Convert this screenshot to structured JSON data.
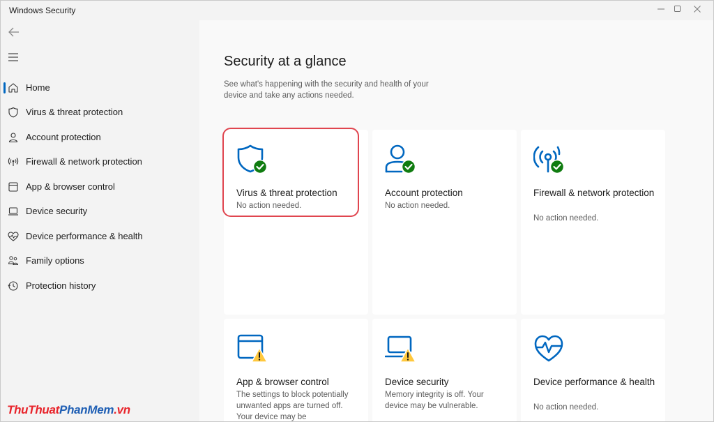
{
  "app": {
    "title": "Windows Security"
  },
  "window_controls": {
    "minimize": "minimize-icon",
    "maximize": "maximize-icon",
    "close": "close-icon"
  },
  "sidebar": {
    "items": [
      {
        "label": "Home",
        "icon": "home-icon",
        "active": true
      },
      {
        "label": "Virus & threat protection",
        "icon": "shield-icon"
      },
      {
        "label": "Account protection",
        "icon": "person-icon"
      },
      {
        "label": "Firewall & network protection",
        "icon": "antenna-icon"
      },
      {
        "label": "App & browser control",
        "icon": "app-window-icon"
      },
      {
        "label": "Device security",
        "icon": "laptop-icon"
      },
      {
        "label": "Device performance & health",
        "icon": "heart-pulse-icon"
      },
      {
        "label": "Family options",
        "icon": "family-icon"
      },
      {
        "label": "Protection history",
        "icon": "history-icon"
      }
    ]
  },
  "main": {
    "title": "Security at a glance",
    "subtitle": "See what's happening with the security and health of your device and take any actions needed.",
    "cards": [
      {
        "title": "Virus & threat protection",
        "status": "No action needed.",
        "icon": "shield-check-icon",
        "state": "ok"
      },
      {
        "title": "Account protection",
        "status": "No action needed.",
        "icon": "person-check-icon",
        "state": "ok"
      },
      {
        "title": "Firewall & network protection",
        "status": "No action needed.",
        "icon": "antenna-check-icon",
        "state": "ok"
      },
      {
        "title": "App & browser control",
        "status": "The settings to block potentially unwanted apps are turned off. Your device may be",
        "icon": "app-window-warning-icon",
        "state": "warning"
      },
      {
        "title": "Device security",
        "status": "Memory integrity is off. Your device may be vulnerable.",
        "icon": "laptop-warning-icon",
        "state": "warning"
      },
      {
        "title": "Device performance & health",
        "status": "No action needed.",
        "icon": "heart-check-icon",
        "state": "ok"
      }
    ]
  },
  "watermark": {
    "part1": "ThuThuat",
    "part2": "PhanMem",
    "part3": ".vn"
  },
  "colors": {
    "accent": "#0067c0",
    "ok": "#107c10",
    "warning": "#ffc83d",
    "highlight": "#e0454f"
  }
}
